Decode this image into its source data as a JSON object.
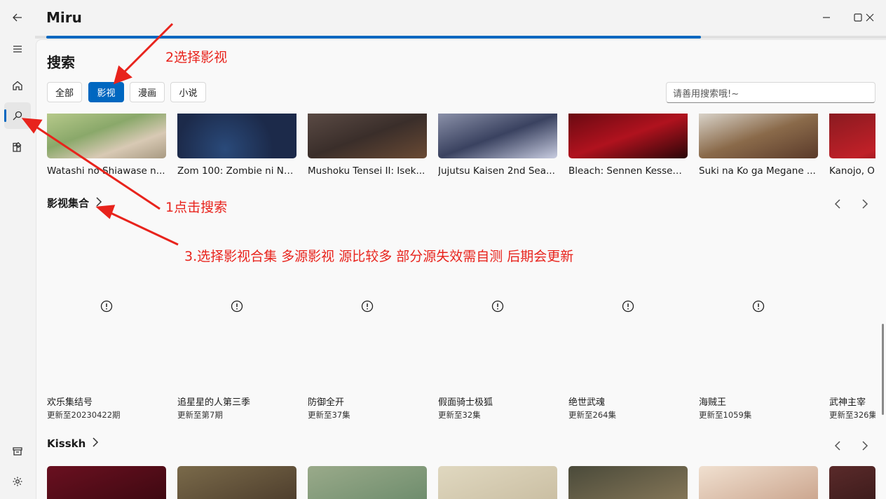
{
  "titlebar": {
    "title": "Miru",
    "back_icon": "back-arrow-icon",
    "progress_pct": 76
  },
  "rail": {
    "items": [
      {
        "name": "menu-icon"
      },
      {
        "name": "home-icon"
      },
      {
        "name": "search-icon",
        "active": true
      },
      {
        "name": "extensions-icon"
      },
      {
        "name": "archive-icon"
      },
      {
        "name": "settings-icon"
      }
    ]
  },
  "page": {
    "title": "搜索"
  },
  "filters": [
    {
      "label": "全部",
      "selected": false
    },
    {
      "label": "影视",
      "selected": true
    },
    {
      "label": "漫画",
      "selected": false
    },
    {
      "label": "小说",
      "selected": false
    }
  ],
  "search": {
    "placeholder": "请善用搜索哦!~"
  },
  "top_row": [
    {
      "title": "Watashi no Shiawase n..."
    },
    {
      "title": "Zom 100: Zombie ni Na..."
    },
    {
      "title": "Mushoku Tensei II: Isek..."
    },
    {
      "title": "Jujutsu Kaisen 2nd Sea..."
    },
    {
      "title": "Bleach: Sennen Kessen-..."
    },
    {
      "title": "Suki na Ko ga Megane ..."
    },
    {
      "title": "Kanojo, O"
    }
  ],
  "section_collection": {
    "title": "影视集合",
    "items": [
      {
        "name": "欢乐集结号",
        "sub": "更新至20230422期"
      },
      {
        "name": "追星星的人第三季",
        "sub": "更新至第7期"
      },
      {
        "name": "防御全开",
        "sub": "更新至37集"
      },
      {
        "name": "假面骑士极狐",
        "sub": "更新至32集"
      },
      {
        "name": "绝世武魂",
        "sub": "更新至264集"
      },
      {
        "name": "海贼王",
        "sub": "更新至1059集"
      },
      {
        "name": "武神主宰",
        "sub": "更新至326集"
      }
    ]
  },
  "section_kisskh": {
    "title": "Kisskh"
  },
  "annotations": {
    "step1": "1点击搜索",
    "step2": "2选择影视",
    "step3": "3.选择影视合集  多源影视  源比较多 部分源失效需自测 后期会更新"
  },
  "colors": {
    "accent": "#0067c0",
    "annotation": "#e8231c"
  }
}
